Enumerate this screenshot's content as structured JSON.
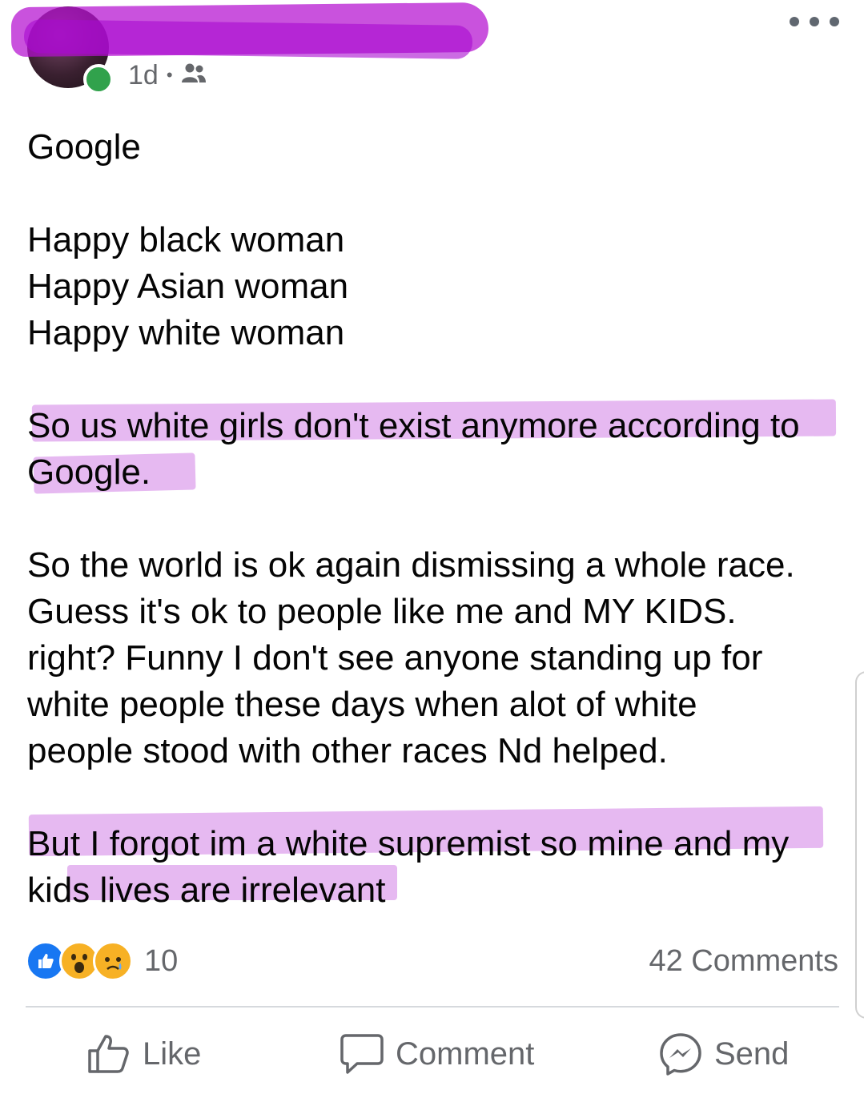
{
  "post": {
    "timestamp": "1d",
    "separator": "•",
    "audience_icon": "friends-icon",
    "more_icon": "more-options-icon",
    "body": {
      "line1": "Google",
      "line2": "Happy black woman",
      "line3": "Happy Asian woman",
      "line4": "Happy white woman",
      "p2_line1": "So us white girls don't exist anymore according to",
      "p2_line2": "Google.",
      "p3_line1": "So the world is ok again dismissing a whole race.",
      "p3_line2": "Guess it's ok to people like me and MY KIDS.",
      "p3_line3": "right? Funny I don't see anyone standing up for",
      "p3_line4": "white people these days when alot of white",
      "p3_line5": "people stood with other races Nd helped.",
      "p4_line1": "But I forgot im a white supremist so mine and my",
      "p4_line2": "kids lives are irrelevant"
    },
    "reactions": {
      "icons": [
        "like-reaction-icon",
        "wow-reaction-icon",
        "sad-reaction-icon"
      ],
      "count": "10"
    },
    "comments_count": "42 Comments",
    "actions": {
      "like": "Like",
      "comment": "Comment",
      "send": "Send"
    },
    "colors": {
      "highlight": "#d78ee8",
      "redaction": "#b40fd0",
      "like_blue": "#1877f2",
      "online_green": "#31a24c",
      "meta_gray": "#65676b"
    }
  }
}
